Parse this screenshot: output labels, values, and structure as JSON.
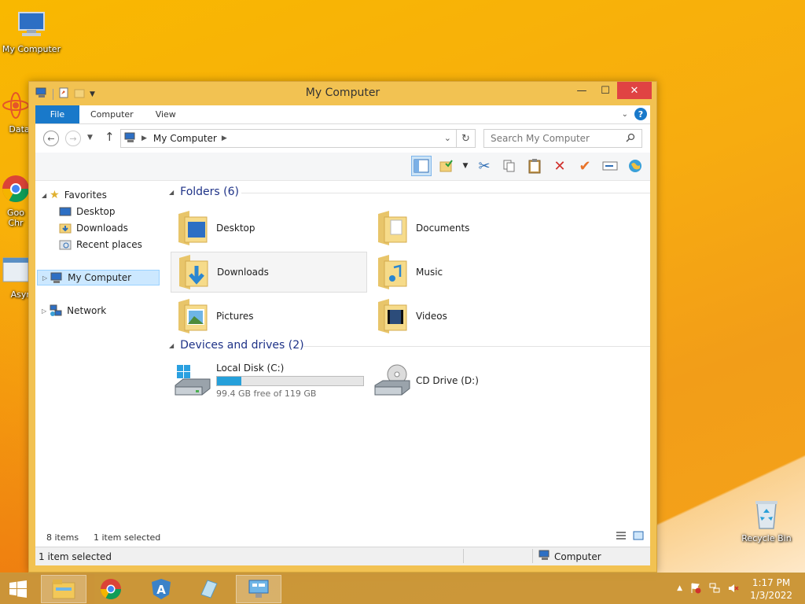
{
  "desktop": {
    "icons": [
      {
        "label": "My Computer"
      },
      {
        "label": "DataW"
      },
      {
        "label": "Goo Chr"
      },
      {
        "label": "Async"
      },
      {
        "label": "Recycle Bin"
      }
    ]
  },
  "window": {
    "title": "My Computer",
    "controls": {
      "minimize": "—",
      "maximize": "☐",
      "close": "✕"
    }
  },
  "ribbon": {
    "tabs": [
      "File",
      "Computer",
      "View"
    ]
  },
  "nav": {
    "address": "My Computer",
    "search_placeholder": "Search My Computer"
  },
  "navpane": {
    "favorites": "Favorites",
    "desktop": "Desktop",
    "downloads": "Downloads",
    "recent": "Recent places",
    "my_computer": "My Computer",
    "network": "Network"
  },
  "content": {
    "folders_header": "Folders (6)",
    "folders": [
      "Desktop",
      "Documents",
      "Downloads",
      "Music",
      "Pictures",
      "Videos"
    ],
    "drives_header": "Devices and drives (2)",
    "drive_c": {
      "name": "Local Disk (C:)",
      "free_text": "99.4 GB free of 119 GB",
      "used_fraction": 0.165
    },
    "drive_d": {
      "name": "CD Drive (D:)"
    }
  },
  "status": {
    "items": "8 items",
    "selected": "1 item selected",
    "bar_selected": "1 item selected",
    "bar_location": "Computer"
  },
  "taskbar": {
    "time": "1:17 PM",
    "date": "1/3/2022"
  },
  "colors": {
    "accent": "#1979ca",
    "drive_fill": "#26a0da",
    "close_button": "#e04343",
    "group_title": "#1e3287"
  }
}
